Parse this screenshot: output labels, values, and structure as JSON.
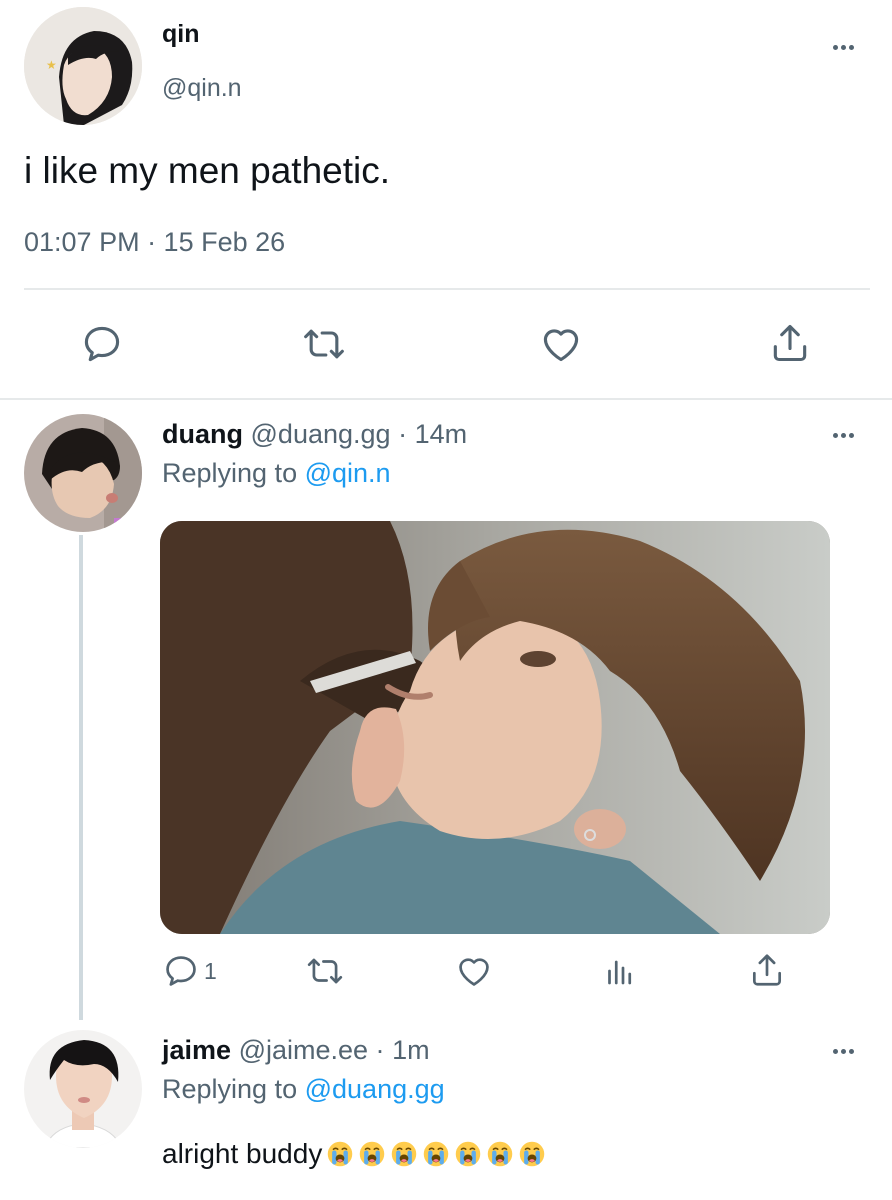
{
  "main_tweet": {
    "display_name": "qin",
    "handle": "@qin.n",
    "text": "i like my men pathetic.",
    "timestamp": "01:07 PM · 15 Feb 26",
    "actions": [
      "reply-icon",
      "retweet-icon",
      "like-icon",
      "share-icon"
    ]
  },
  "reply_1": {
    "display_name": "duang",
    "handle": "@duang.gg",
    "dot": "·",
    "time": "14m",
    "replying_prefix": "Replying to",
    "replying_to": "@qin.n",
    "reply_count": "1",
    "actions": [
      "reply-icon",
      "retweet-icon",
      "like-icon",
      "analytics-icon",
      "share-icon"
    ]
  },
  "reply_2": {
    "display_name": "jaime",
    "handle": "@jaime.ee",
    "dot": "·",
    "time": "1m",
    "replying_prefix": "Replying to",
    "replying_to": "@duang.gg",
    "text": "alright buddy",
    "emojis": [
      "😭",
      "😭",
      "😭",
      "😭",
      "😭",
      "😭",
      "😭"
    ]
  },
  "colors": {
    "text": "#0f1419",
    "muted": "#536471",
    "link": "#1d9bf0",
    "divider": "#e6e9ea",
    "thread_line": "#cfd9de"
  }
}
